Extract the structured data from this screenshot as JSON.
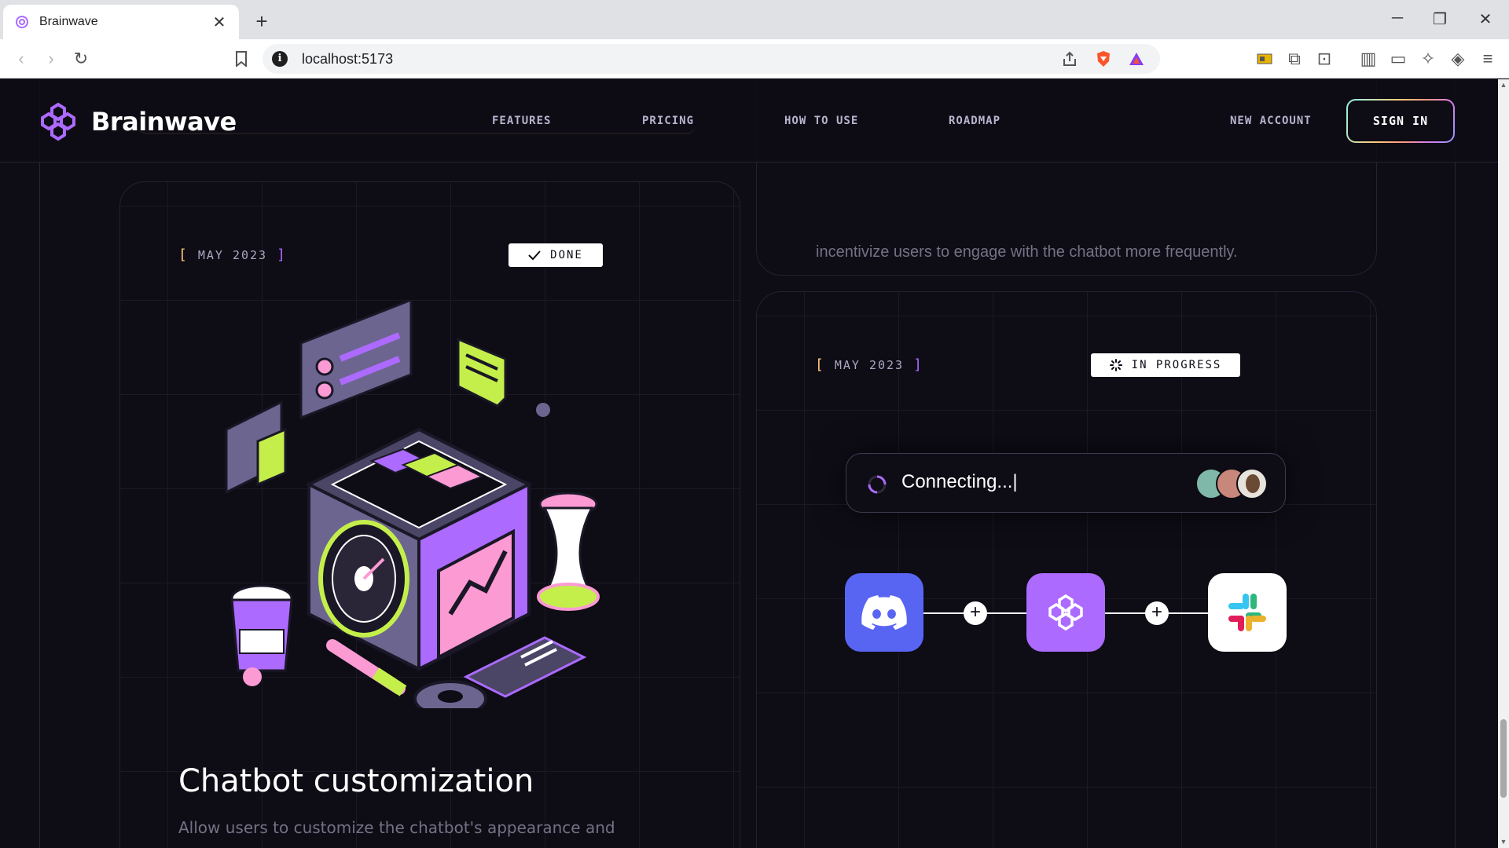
{
  "browser": {
    "tab_title": "Brainwave",
    "url": "localhost:5173"
  },
  "header": {
    "logo_text": "Brainwave",
    "nav": [
      "FEATURES",
      "PRICING",
      "HOW TO USE",
      "ROADMAP"
    ],
    "new_account": "NEW ACCOUNT",
    "sign_in": "SIGN IN"
  },
  "roadmap": {
    "top_right_text": "incentivize users to engage with the chatbot more frequently.",
    "card_left": {
      "date": "MAY 2023",
      "status": "DONE",
      "title": "Chatbot customization",
      "text": "Allow users to customize the chatbot's appearance and"
    },
    "card_right": {
      "date": "MAY 2023",
      "status": "IN PROGRESS",
      "connecting_text": "Connecting...|"
    }
  },
  "colors": {
    "background": "#0e0c15",
    "accent_purple": "#ac6aff",
    "accent_yellow": "#ffc876",
    "discord": "#5865f2",
    "lime": "#c4ef4b"
  },
  "icons": [
    "brainwave-logo-icon",
    "discord-icon",
    "slack-icon",
    "check-icon",
    "spinner-icon"
  ]
}
